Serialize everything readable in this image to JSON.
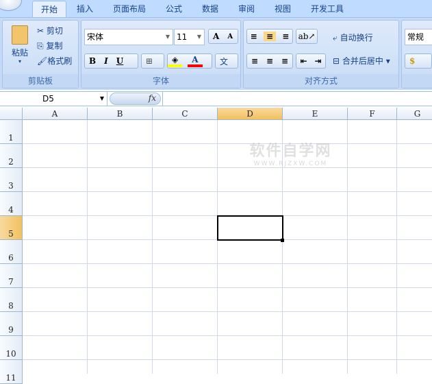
{
  "tabs": [
    "开始",
    "插入",
    "页面布局",
    "公式",
    "数据",
    "审阅",
    "视图",
    "开发工具"
  ],
  "clipboard": {
    "paste": "粘贴",
    "cut": "剪切",
    "copy": "复制",
    "format_painter": "格式刷",
    "label": "剪贴板"
  },
  "font": {
    "name": "宋体",
    "size": "11",
    "bold": "B",
    "italic": "I",
    "underline": "U",
    "font_color": "A",
    "phonetic": "文",
    "label": "字体",
    "fill_color": "#ffff00",
    "text_color": "#ff0000"
  },
  "alignment": {
    "wrap": "自动换行",
    "merge": "合并后居中",
    "label": "对齐方式"
  },
  "number": {
    "format": "常规"
  },
  "formula_bar": {
    "name_box": "D5",
    "fx": "fx",
    "value": ""
  },
  "columns": [
    "A",
    "B",
    "C",
    "D",
    "E",
    "F",
    "G"
  ],
  "rows": [
    "1",
    "2",
    "3",
    "4",
    "5",
    "6",
    "7",
    "8",
    "9",
    "10",
    "11"
  ],
  "selected_cell": "D5",
  "watermark": {
    "title": "软件自学网",
    "url": "WWW.RJZXW.COM"
  }
}
